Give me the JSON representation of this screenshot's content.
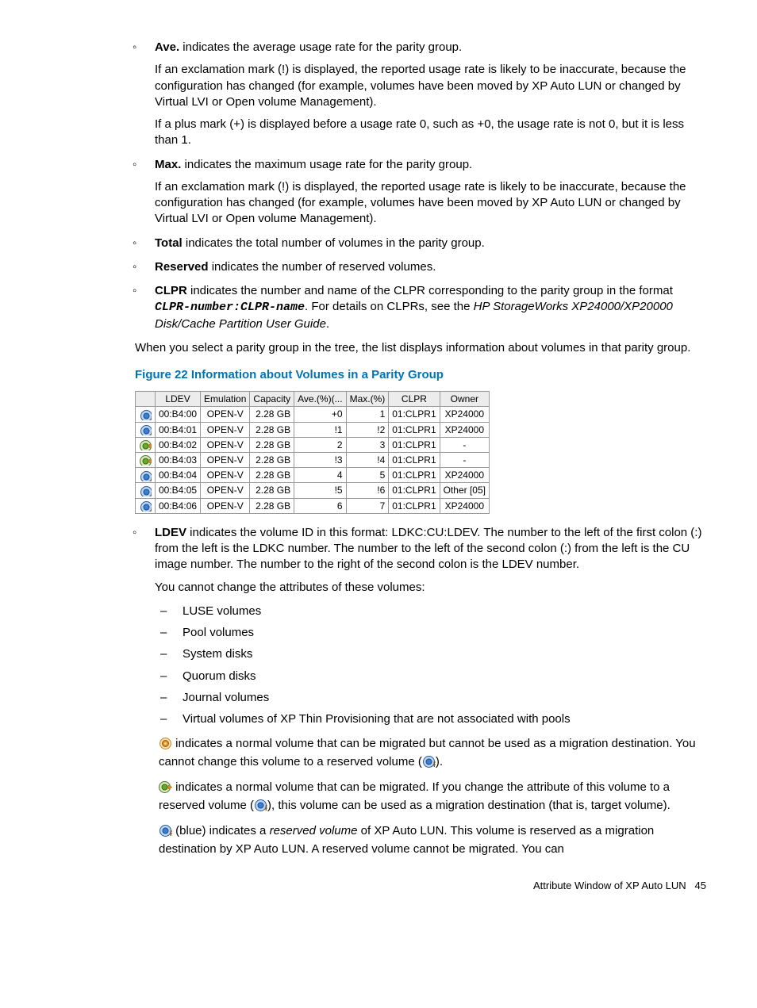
{
  "bullets": {
    "ave": {
      "title": "Ave.",
      "lead": " indicates the average usage rate for the parity group.",
      "p1": "If an exclamation mark (!) is displayed, the reported usage rate is likely to be inaccurate, because the configuration has changed (for example, volumes have been moved by XP Auto LUN or changed by Virtual LVI or Open volume Management).",
      "p2": "If a plus mark (+) is displayed before a usage rate 0, such as +0, the usage rate is not 0, but it is less than 1."
    },
    "max": {
      "title": "Max.",
      "lead": " indicates the maximum usage rate for the parity group.",
      "p1": "If an exclamation mark (!) is displayed, the reported usage rate is likely to be inaccurate, because the configuration has changed (for example, volumes have been moved by XP Auto LUN or changed by Virtual LVI or Open volume Management)."
    },
    "total": {
      "title": "Total",
      "lead": " indicates the total number of volumes in the parity group."
    },
    "reserved": {
      "title": "Reserved",
      "lead": " indicates the number of reserved volumes."
    },
    "clpr": {
      "title": "CLPR",
      "lead_a": " indicates the number and name of the CLPR corresponding to the parity group in the format ",
      "code": "CLPR-number:CLPR-name",
      "lead_b": ". For details on CLPRs, see the ",
      "ref": "HP StorageWorks XP24000/XP20000 Disk/Cache Partition User Guide",
      "lead_c": "."
    }
  },
  "select_para": "When you select a parity group in the tree, the list displays information about volumes in that parity group.",
  "figure_caption": "Figure 22 Information about Volumes in a Parity Group",
  "table": {
    "headers": [
      "LDEV",
      "Emulation",
      "Capacity",
      "Ave.(%)(...",
      "Max.(%)",
      "CLPR",
      "Owner"
    ],
    "rows": [
      {
        "icon": "reserved",
        "ldev": "00:B4:00",
        "emu": "OPEN-V",
        "cap": "2.28 GB",
        "ave": "+0",
        "max": "1",
        "clpr": "01:CLPR1",
        "owner": "XP24000"
      },
      {
        "icon": "reserved",
        "ldev": "00:B4:01",
        "emu": "OPEN-V",
        "cap": "2.28 GB",
        "ave": "!1",
        "max": "!2",
        "clpr": "01:CLPR1",
        "owner": "XP24000"
      },
      {
        "icon": "migratable",
        "ldev": "00:B4:02",
        "emu": "OPEN-V",
        "cap": "2.28 GB",
        "ave": "2",
        "max": "3",
        "clpr": "01:CLPR1",
        "owner": "-"
      },
      {
        "icon": "migratable",
        "ldev": "00:B4:03",
        "emu": "OPEN-V",
        "cap": "2.28 GB",
        "ave": "!3",
        "max": "!4",
        "clpr": "01:CLPR1",
        "owner": "-"
      },
      {
        "icon": "reserved",
        "ldev": "00:B4:04",
        "emu": "OPEN-V",
        "cap": "2.28 GB",
        "ave": "4",
        "max": "5",
        "clpr": "01:CLPR1",
        "owner": "XP24000"
      },
      {
        "icon": "reserved",
        "ldev": "00:B4:05",
        "emu": "OPEN-V",
        "cap": "2.28 GB",
        "ave": "!5",
        "max": "!6",
        "clpr": "01:CLPR1",
        "owner": "Other [05]"
      },
      {
        "icon": "reserved",
        "ldev": "00:B4:06",
        "emu": "OPEN-V",
        "cap": "2.28 GB",
        "ave": "6",
        "max": "7",
        "clpr": "01:CLPR1",
        "owner": "XP24000"
      }
    ]
  },
  "ldev": {
    "title": "LDEV",
    "lead": " indicates the volume ID in this format: LDKC:CU:LDEV. The number to the left of the first colon (:) from the left is the LDKC number. The number to the left of the second colon (:) from the left is the CU image number. The number to the right of the second colon is the LDEV number.",
    "cannot": "You cannot change the attributes of these volumes:",
    "list": [
      "LUSE volumes",
      "Pool volumes",
      "System disks",
      "Quorum disks",
      "Journal volumes",
      "Virtual volumes of XP Thin Provisioning that are not associated with pools"
    ]
  },
  "icon_descs": {
    "nomig_a": " indicates a normal volume that can be migrated but cannot be used as a migration destination. You cannot change this volume to a reserved volume (",
    "nomig_b": ").",
    "mig_a": " indicates a normal volume that can be migrated. If you change the attribute of this volume to a reserved volume (",
    "mig_b": "), this volume can be used as a migration destination (that is, target volume).",
    "res_a": " (blue) indicates a ",
    "res_i": "reserved volume",
    "res_b": " of XP Auto LUN. This volume is reserved as a migration destination by XP Auto LUN. A reserved volume cannot be migrated. You can"
  },
  "footer": {
    "label": "Attribute Window of XP Auto LUN",
    "page": "45"
  }
}
